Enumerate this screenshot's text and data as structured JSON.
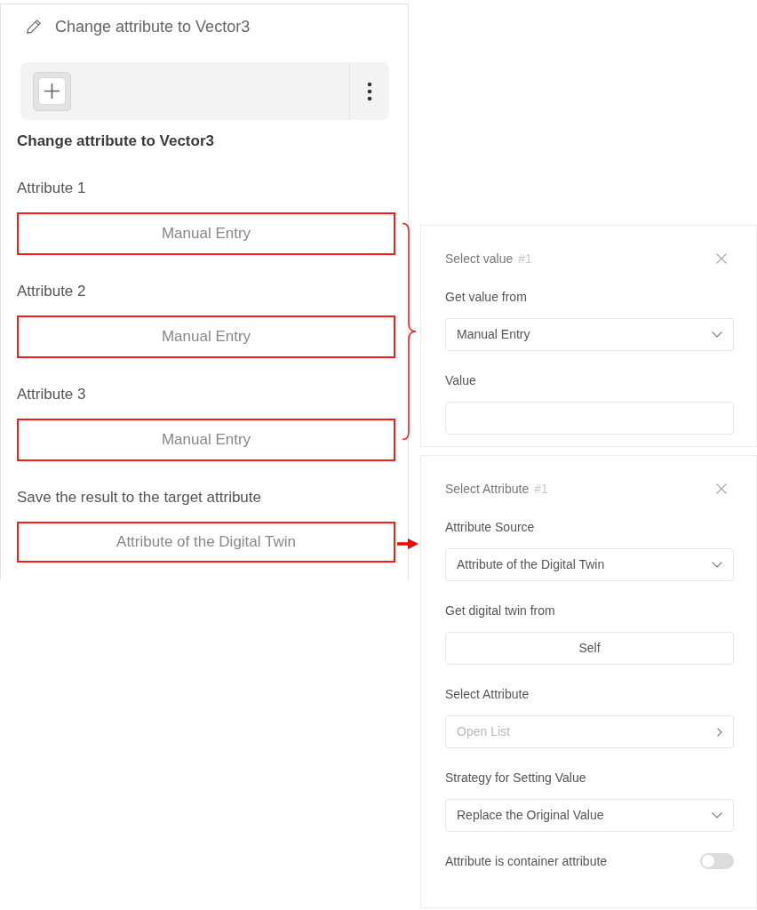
{
  "editor": {
    "title": "Change attribute to Vector3"
  },
  "block": {
    "title": "Change attribute to Vector3",
    "inputs": [
      {
        "label": "Attribute 1",
        "value": "Manual Entry",
        "highlighted": true
      },
      {
        "label": "Attribute 2",
        "value": "Manual Entry",
        "highlighted": true
      },
      {
        "label": "Attribute 3",
        "value": "Manual Entry",
        "highlighted": true
      }
    ],
    "target": {
      "label": "Save the result to the target attribute",
      "value": "Attribute of the Digital Twin",
      "highlighted": true
    }
  },
  "select_value_panel": {
    "title": "Select value",
    "number": "#1",
    "fields": [
      {
        "kind": "select",
        "label": "Get value from",
        "value": "Manual Entry"
      },
      {
        "kind": "input",
        "label": "Value"
      }
    ]
  },
  "select_attribute_panel": {
    "title": "Select Attribute",
    "number": "#1",
    "fields": [
      {
        "kind": "select",
        "label": "Attribute Source",
        "value": "Attribute of the Digital Twin"
      },
      {
        "kind": "button",
        "label": "Get digital twin from",
        "value": "Self"
      },
      {
        "kind": "picker",
        "label": "Select Attribute",
        "placeholder": "Open List"
      },
      {
        "kind": "select",
        "label": "Strategy for Setting Value",
        "value": "Replace the Original Value"
      },
      {
        "kind": "toggle",
        "label": "Attribute is container attribute",
        "on": false
      }
    ]
  }
}
